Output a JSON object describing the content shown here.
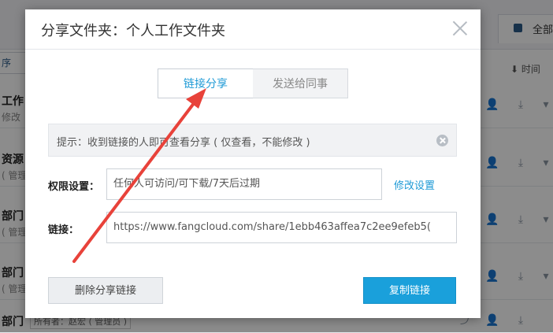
{
  "background": {
    "tab_label": "全部",
    "sort_label": "序",
    "time_label": "时间",
    "rows": [
      {
        "title": "工作",
        "sub": "修改"
      },
      {
        "title": "资源",
        "sub": "( 管理"
      },
      {
        "title": "部门",
        "sub": "( 管理"
      },
      {
        "title": "部门",
        "sub": "( 管理"
      },
      {
        "title": "部门",
        "sub": "所有者：赵宏 ( 管理员 )"
      }
    ]
  },
  "modal": {
    "title": "分享文件夹：个人工作文件夹",
    "tabs": [
      {
        "label": "链接分享",
        "active": true
      },
      {
        "label": "发送给同事",
        "active": false
      }
    ],
    "hint": "提示：收到链接的人即可查看分享 ( 仅查看，不能修改 )",
    "permission_label": "权限设置：",
    "permission_value": "任何人可访问/可下载/7天后过期",
    "modify_label": "修改设置",
    "link_label": "链接：",
    "link_value": "https://www.fangcloud.com/share/1ebb463affea7c2ee9efeb5(",
    "delete_button": "删除分享链接",
    "copy_button": "复制链接"
  },
  "colors": {
    "accent": "#1aa0db",
    "annotation": "#e8423a"
  },
  "icons": {
    "close": "close-icon",
    "hint_close": "close-circle-icon",
    "row_actions": [
      "user-icon",
      "download-icon",
      "chevron-down-icon"
    ]
  }
}
